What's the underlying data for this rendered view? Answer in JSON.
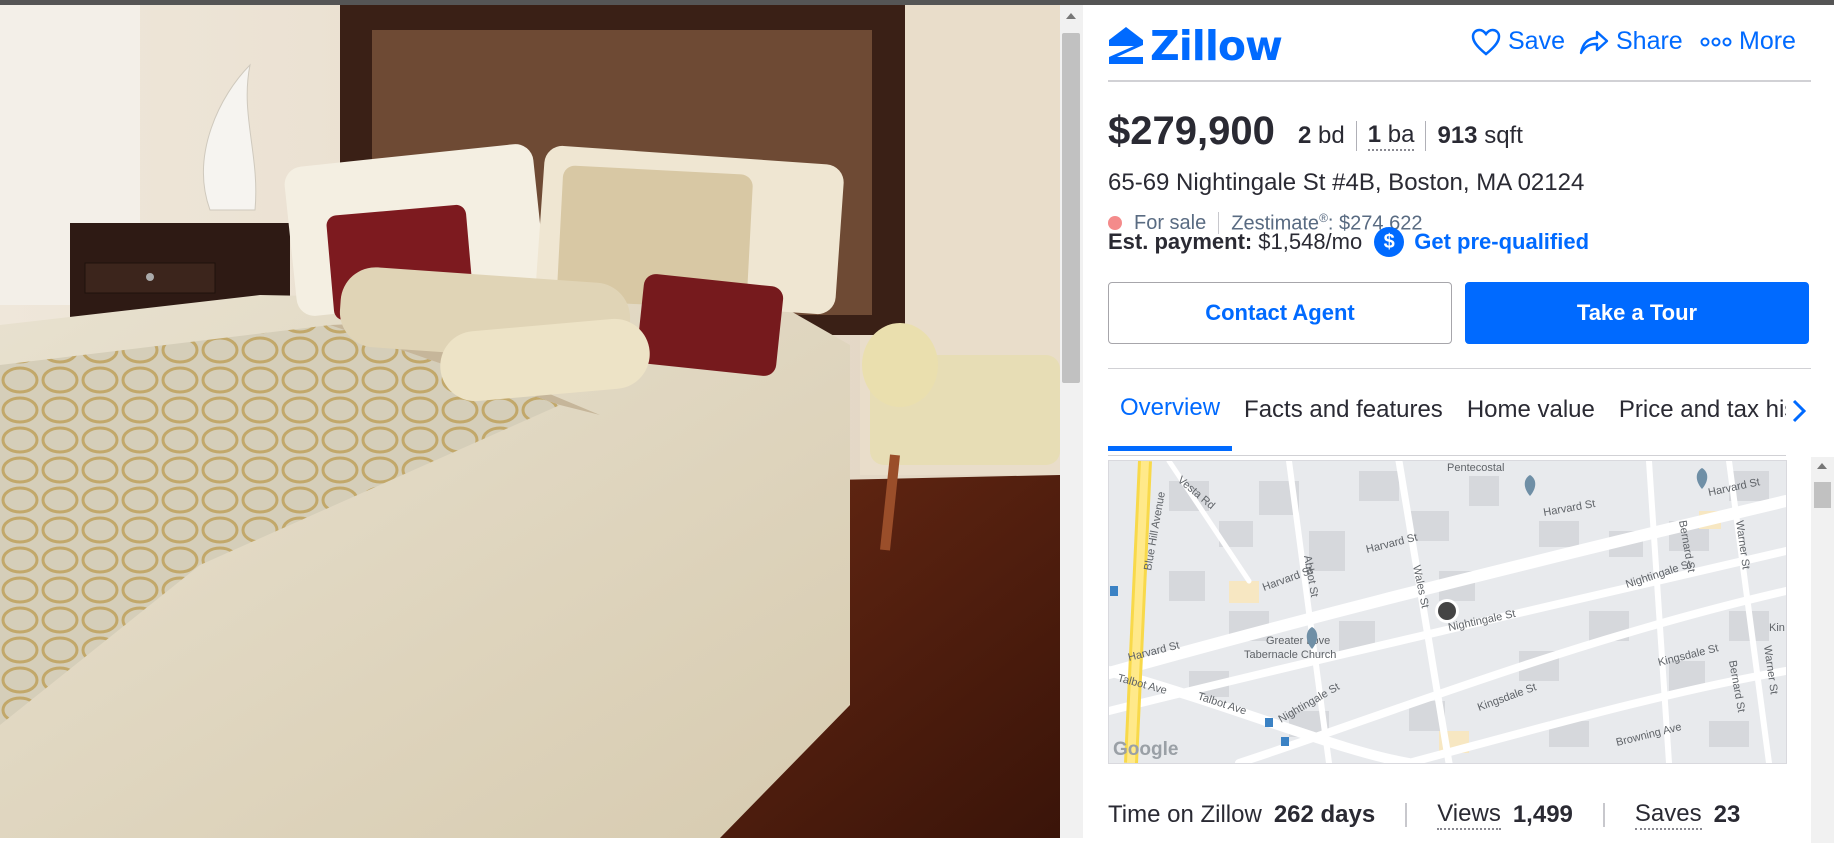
{
  "photo": {
    "alt": "Bedroom with queen bed, decorative pillows, nightstand and bench"
  },
  "header": {
    "logo_text": "Zillow",
    "save_label": "Save",
    "share_label": "Share",
    "more_label": "More"
  },
  "listing": {
    "price": "$279,900",
    "beds_value": "2",
    "beds_unit": "bd",
    "baths_value": "1",
    "baths_unit": "ba",
    "sqft_value": "913",
    "sqft_unit": "sqft",
    "address": "65-69 Nightingale St #4B, Boston, MA 02124",
    "status": "For sale",
    "zestimate_label": "Zestimate",
    "zestimate_sup": "®",
    "zestimate_value": ": $274,622",
    "est_payment_label": "Est. payment:",
    "est_payment_value": "$1,548/mo",
    "prequal_label": "Get pre-qualified",
    "dollar_symbol": "$"
  },
  "actions": {
    "contact_label": "Contact Agent",
    "tour_label": "Take a Tour"
  },
  "tabs": [
    {
      "label": "Overview",
      "active": true
    },
    {
      "label": "Facts and features",
      "active": false
    },
    {
      "label": "Home value",
      "active": false
    },
    {
      "label": "Price and tax history",
      "active": false
    }
  ],
  "map": {
    "labels": {
      "blue_hill_ave": "Blue Hill Avenue",
      "vesta_rd": "Vesta Rd",
      "abbot_st": "Abbot St",
      "pentecostal": "Pentecostal",
      "harvard_st_1": "Harvard St",
      "harvard_st_2": "Harvard St",
      "harvard_st_3": "Harvard St",
      "harvard_st_4": "Harvard St",
      "harvard_st_5": "Harvard St",
      "wales_st": "Wales St",
      "bernard_st_1": "Bernard St",
      "bernard_st_2": "Bernard St",
      "warner_st_1": "Warner St",
      "warner_st_2": "Warner St",
      "nightingale_st_1": "Nightingale St",
      "nightingale_st_2": "Nightingale St",
      "nightingale_st_3": "Nightingale St",
      "church_1": "Greater Love",
      "church_2": "Tabernacle Church",
      "talbot_ave_1": "Talbot Ave",
      "talbot_ave_2": "Talbot Ave",
      "kingsdale_st_1": "Kingsdale St",
      "kingsdale_st_2": "Kingsdale St",
      "browning_ave": "Browning Ave",
      "kin": "Kin",
      "google": "Google"
    }
  },
  "stats": {
    "time_label": "Time on Zillow",
    "time_value": "262 days",
    "views_label": "Views",
    "views_value": "1,499",
    "saves_label": "Saves",
    "saves_value": "23"
  },
  "colors": {
    "brand_blue": "#006aff",
    "text": "#2a2a33",
    "for_sale_dot": "#f48b8b"
  },
  "icons": [
    "zillow-logo-icon",
    "heart-icon",
    "share-icon",
    "more-dots-icon",
    "dollar-icon",
    "chevron-right-icon",
    "map-pin-icon",
    "church-icon"
  ]
}
